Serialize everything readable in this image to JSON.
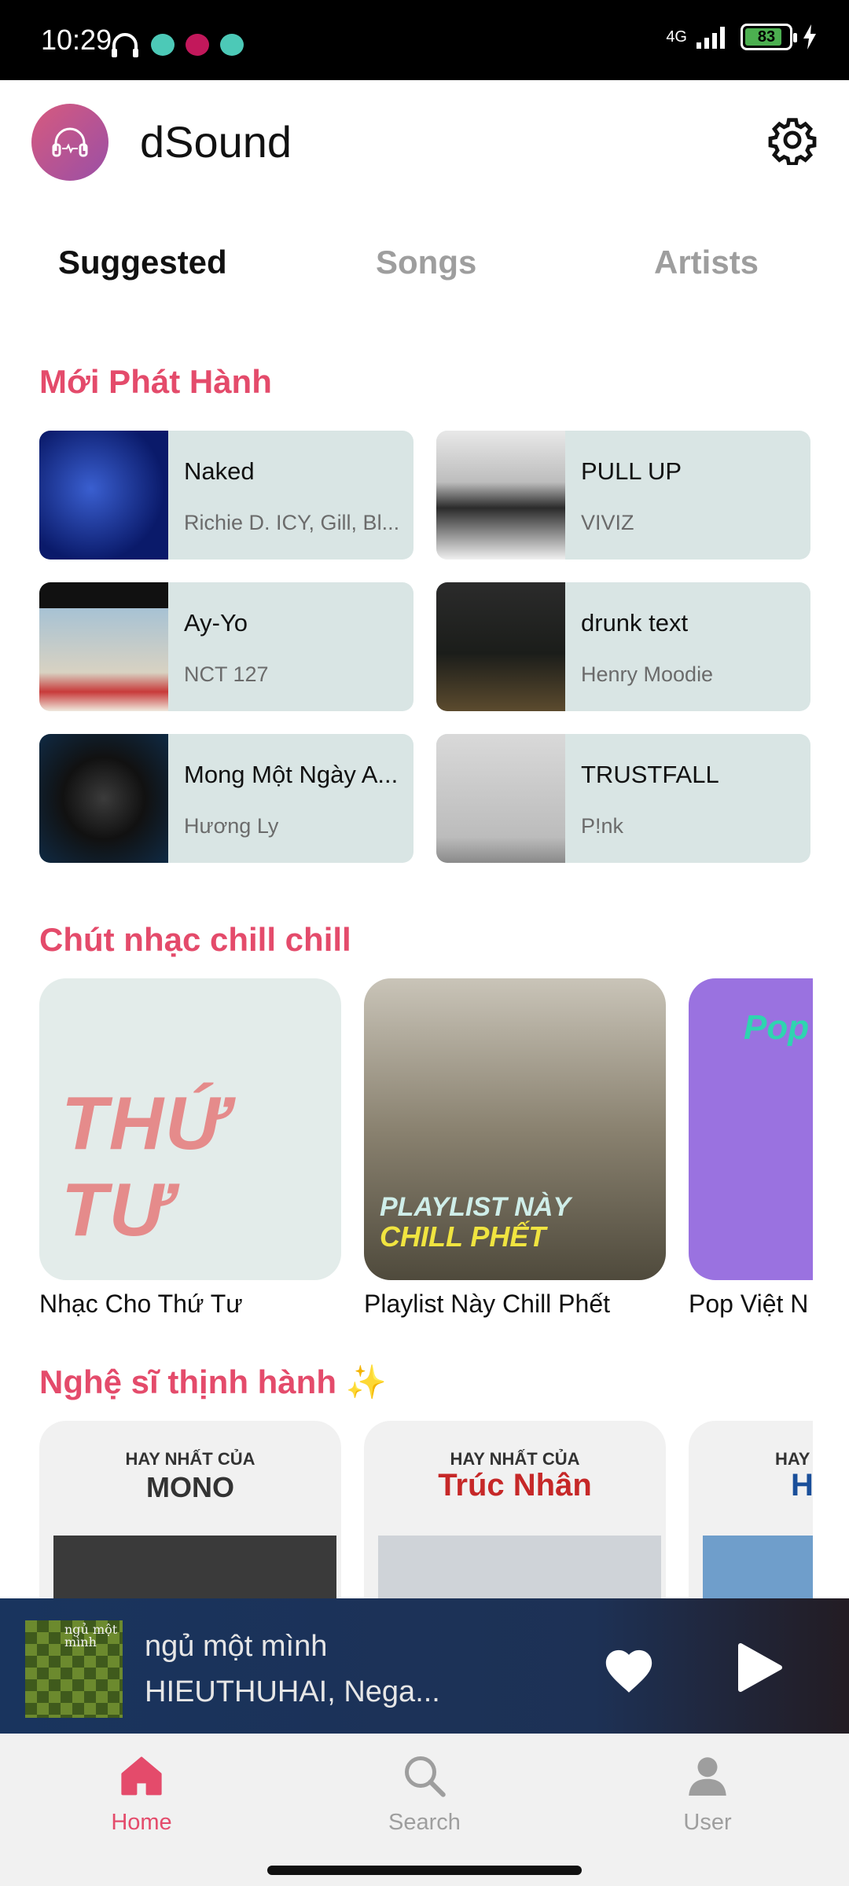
{
  "status_bar": {
    "time": "10:29",
    "network": "4G",
    "battery": "83"
  },
  "app": {
    "title": "dSound"
  },
  "tabs": [
    {
      "label": "Suggested",
      "active": true
    },
    {
      "label": "Songs",
      "active": false
    },
    {
      "label": "Artists",
      "active": false
    }
  ],
  "sections": {
    "new_releases": {
      "title": "Mới Phát Hành",
      "items": [
        {
          "title": "Naked",
          "artist": "Richie D. ICY, Gill, Bl..."
        },
        {
          "title": "PULL UP",
          "artist": "VIVIZ"
        },
        {
          "title": "Ay-Yo",
          "artist": "NCT 127"
        },
        {
          "title": "drunk text",
          "artist": "Henry Moodie"
        },
        {
          "title": "Mong Một Ngày A...",
          "artist": "Hương Ly"
        },
        {
          "title": "TRUSTFALL",
          "artist": "P!nk"
        }
      ]
    },
    "chill": {
      "title": "Chút nhạc chill chill",
      "items": [
        {
          "caption": "Nhạc Cho Thứ Tư",
          "cover_text": "THỨ TƯ"
        },
        {
          "caption": "Playlist Này Chill Phết",
          "cover_text_1": "PLAYLIST NÀY",
          "cover_text_2": "CHILL PHẾT"
        },
        {
          "caption": "Pop Việt N",
          "cover_text": "Pop"
        }
      ]
    },
    "trending_artists": {
      "title": "Nghệ sĩ thịnh hành ✨",
      "items": [
        {
          "overline": "HAY NHẤT CỦA",
          "name": "MONO"
        },
        {
          "overline": "HAY NHẤT CỦA",
          "name": "Trúc Nhân"
        },
        {
          "overline": "HAY",
          "name": "H"
        }
      ]
    }
  },
  "mini_player": {
    "song": "ngủ một mình",
    "artist": "HIEUTHUHAI, Nega...",
    "art_text": "ngủ một mình"
  },
  "bottom_nav": [
    {
      "label": "Home",
      "icon": "home-icon",
      "active": true
    },
    {
      "label": "Search",
      "icon": "search-icon",
      "active": false
    },
    {
      "label": "User",
      "icon": "user-icon",
      "active": false
    }
  ],
  "colors": {
    "accent": "#e44b6b",
    "card_bg": "#d9e5e4",
    "player_bg": "#1d3155"
  }
}
